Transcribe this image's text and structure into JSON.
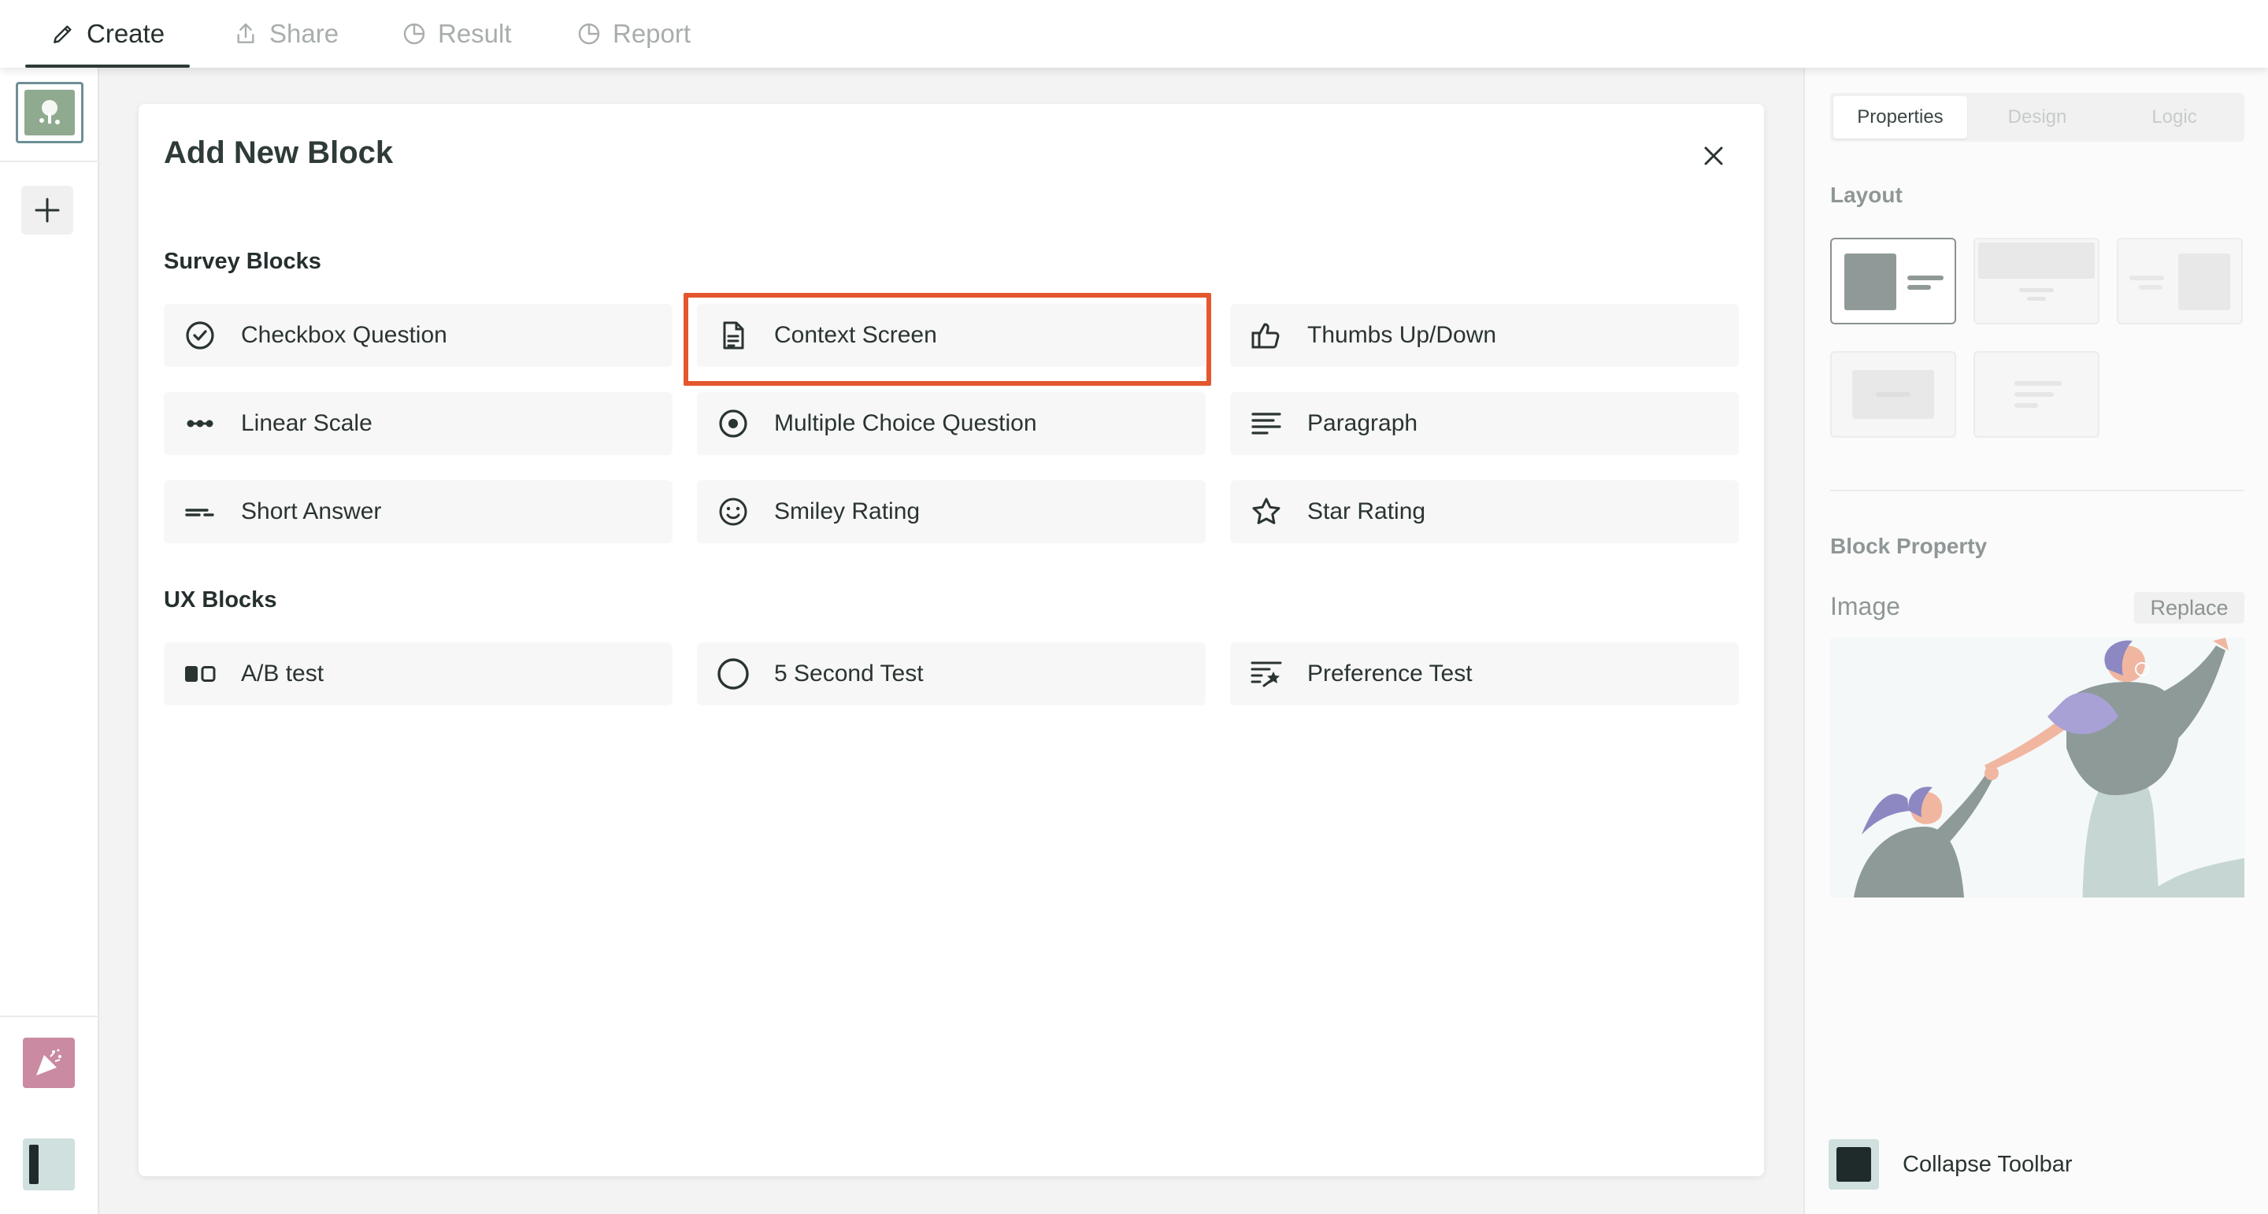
{
  "topnav": {
    "tabs": [
      {
        "label": "Create",
        "icon": "pencil-icon",
        "active": true
      },
      {
        "label": "Share",
        "icon": "share-icon",
        "active": false
      },
      {
        "label": "Result",
        "icon": "pie-chart-icon",
        "active": false
      },
      {
        "label": "Report",
        "icon": "pie-chart-icon",
        "active": false
      }
    ]
  },
  "modal": {
    "title": "Add New Block",
    "sections": [
      {
        "title": "Survey Blocks",
        "items": [
          {
            "label": "Checkbox Question",
            "icon": "checkmark-circle-icon"
          },
          {
            "label": "Context Screen",
            "icon": "document-icon"
          },
          {
            "label": "Thumbs Up/Down",
            "icon": "thumbs-up-icon"
          },
          {
            "label": "Linear Scale",
            "icon": "linear-scale-icon"
          },
          {
            "label": "Multiple Choice Question",
            "icon": "radio-icon"
          },
          {
            "label": "Paragraph",
            "icon": "paragraph-icon"
          },
          {
            "label": "Short Answer",
            "icon": "short-answer-icon"
          },
          {
            "label": "Smiley Rating",
            "icon": "smiley-icon"
          },
          {
            "label": "Star Rating",
            "icon": "star-icon"
          }
        ]
      },
      {
        "title": "UX Blocks",
        "items": [
          {
            "label": "A/B test",
            "icon": "ab-test-icon"
          },
          {
            "label": "5 Second Test",
            "icon": "circle-icon"
          },
          {
            "label": "Preference Test",
            "icon": "preference-icon"
          }
        ]
      }
    ],
    "highlight_color": "#e4572e"
  },
  "rightpanel": {
    "tabs": [
      "Properties",
      "Design",
      "Logic"
    ],
    "active_tab": "Properties",
    "layout_label": "Layout",
    "block_property_label": "Block Property",
    "image_label": "Image",
    "replace_label": "Replace",
    "collapse_label": "Collapse Toolbar"
  }
}
